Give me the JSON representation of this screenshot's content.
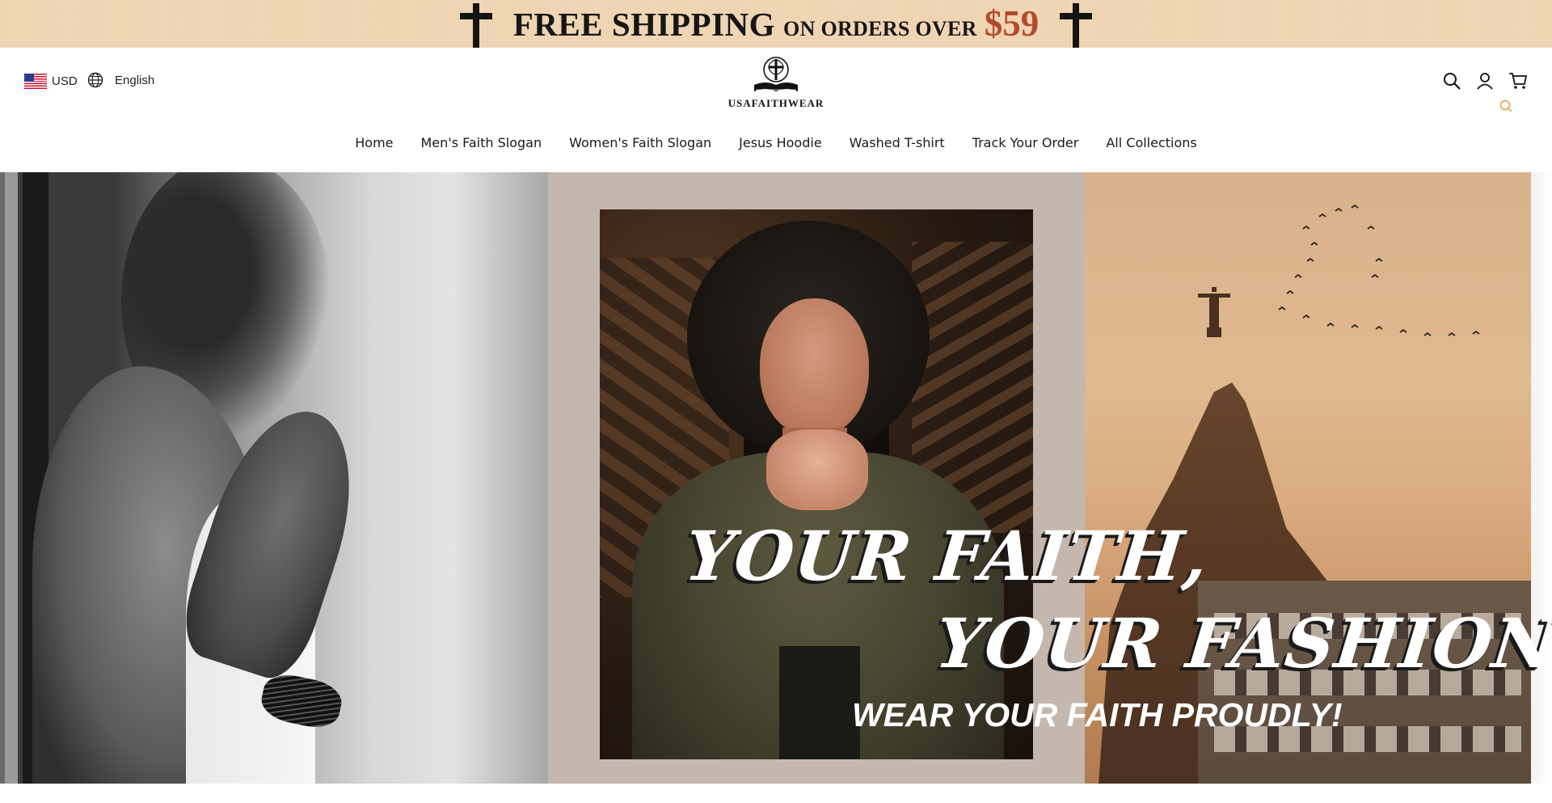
{
  "announcement": {
    "main": "FREE SHIPPING",
    "secondary": "ON ORDERS OVER",
    "price": "$59",
    "price_color": "#b44a2c",
    "background": "#efd4b2"
  },
  "header": {
    "currency": "USD",
    "language": "English",
    "brand": "USAFAITHWEAR",
    "icons": [
      "search-icon",
      "account-icon",
      "cart-icon"
    ]
  },
  "nav": [
    {
      "label": "Home"
    },
    {
      "label": "Men's Faith Slogan"
    },
    {
      "label": "Women's Faith Slogan"
    },
    {
      "label": "Jesus Hoodie"
    },
    {
      "label": "Washed T-shirt"
    },
    {
      "label": "Track Your Order"
    },
    {
      "label": "All Collections"
    }
  ],
  "hero": {
    "headline_1": "YOUR FAITH,",
    "headline_2": "YOUR FASHION",
    "tagline": "WEAR YOUR FAITH PROUDLY!",
    "middle_background": "#c4b7ad"
  }
}
